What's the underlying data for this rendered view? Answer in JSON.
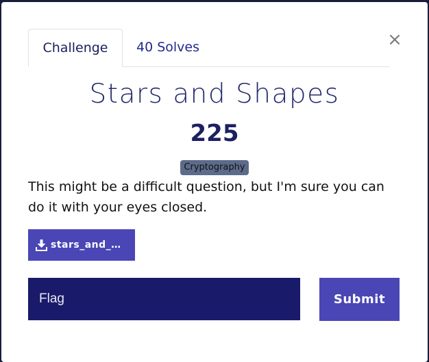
{
  "tabs": [
    {
      "label": "Challenge",
      "active": true
    },
    {
      "label": "40 Solves",
      "active": false
    }
  ],
  "close": {
    "glyph": "×"
  },
  "challenge": {
    "name": "Stars and Shapes",
    "value": "225",
    "category": "Cryptography",
    "description": "This might be a difficult question, but I'm sure you can do it with your eyes closed."
  },
  "files": [
    {
      "name": "stars_and_shapes.zip",
      "display": "stars_and_s…",
      "icon": "download-icon"
    }
  ],
  "flag": {
    "placeholder": "Flag",
    "value": ""
  },
  "submit": {
    "label": "Submit"
  },
  "colors": {
    "primary": "#4a46b5",
    "input_bg": "#1a1a6b",
    "title": "#232a6b",
    "tag_bg": "#5c6b8a"
  }
}
